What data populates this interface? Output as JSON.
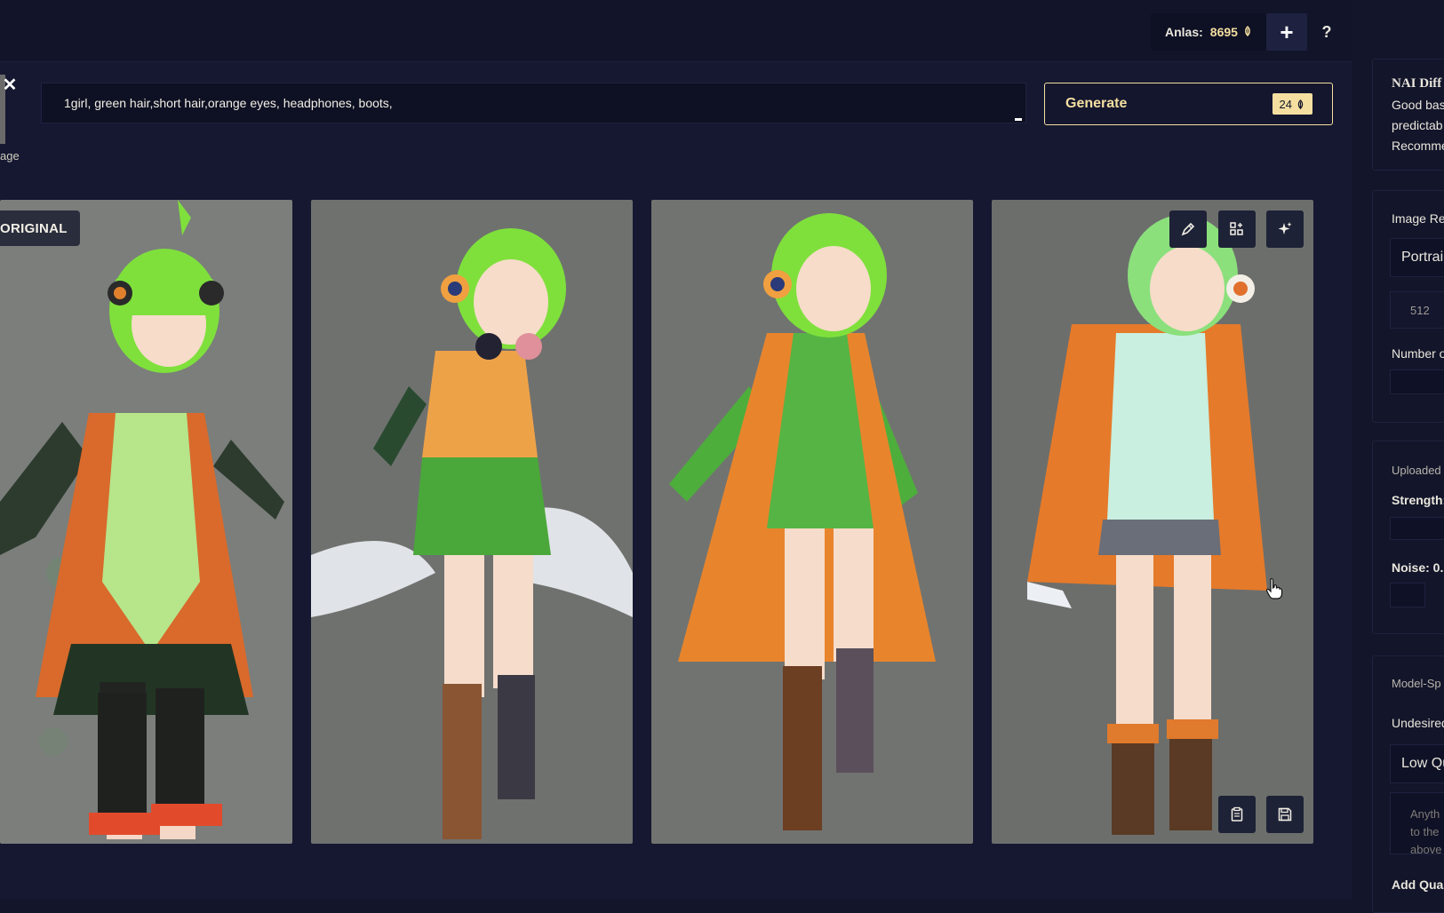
{
  "topbar": {
    "anlas_label": "Anlas:",
    "anlas_value": "8695",
    "plus_label": "+",
    "help_label": "?"
  },
  "left": {
    "close_label": "✕",
    "thumb_label": "age"
  },
  "prompt": {
    "value": "1girl, green hair,short hair,orange eyes, headphones, boots,"
  },
  "generate": {
    "label": "Generate",
    "cost": "24"
  },
  "gallery": {
    "original_badge": "ORIGINAL",
    "images": [
      {
        "name": "original",
        "bg": "#7a7d7a"
      },
      {
        "name": "variation-1",
        "bg": "#6d6f6d"
      },
      {
        "name": "variation-2",
        "bg": "#6f716e"
      },
      {
        "name": "variation-3",
        "bg": "#6b6d6b"
      }
    ],
    "actions_top": [
      "pencil-icon",
      "grid-plus-icon",
      "sparkle-icon"
    ],
    "actions_bottom": [
      "clipboard-icon",
      "save-icon"
    ]
  },
  "right_panel": {
    "model_title": "NAI Diff",
    "model_desc": [
      "Good bas",
      "predictab",
      "Recomme"
    ],
    "image_res_label": "Image Re",
    "image_res_value": "Portrai",
    "width_value": "512",
    "number_label": "Number o",
    "uploaded_label": "Uploaded",
    "strength_label": "Strength:",
    "noise_label": "Noise: 0.",
    "model_specific_label": "Model-Sp",
    "undesired_label": "Undesired",
    "undesired_value": "Low Qu",
    "undesired_placeholder": [
      "Anyth",
      "to the",
      "above"
    ],
    "add_quality_label": "Add Qual"
  },
  "colors": {
    "accent": "#f4dfa0",
    "background": "#161831",
    "panel": "#13152a"
  }
}
